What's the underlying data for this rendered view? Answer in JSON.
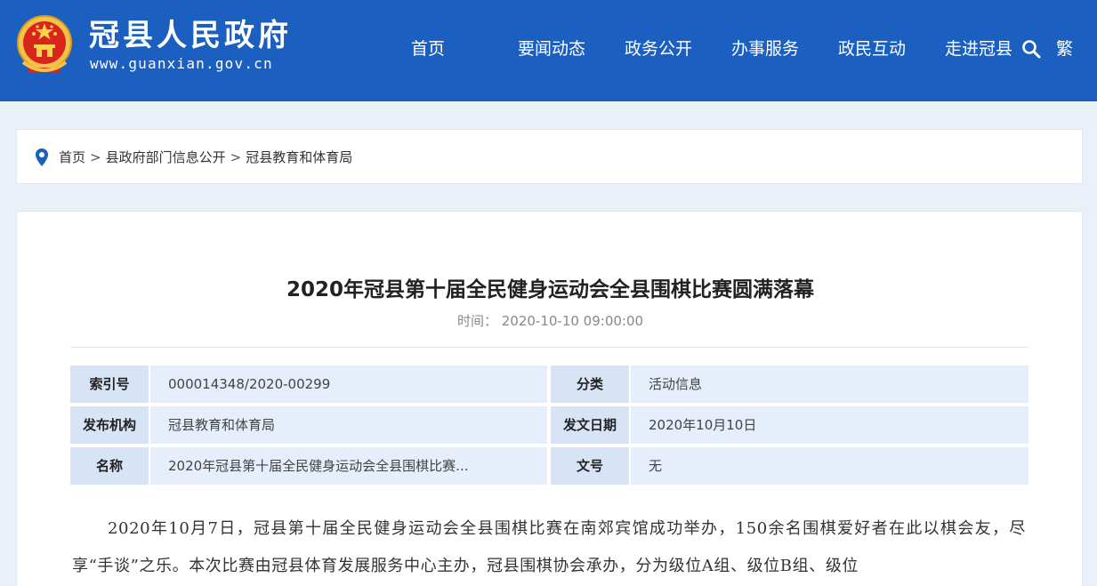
{
  "header": {
    "site_title": "冠县人民政府",
    "site_url": "www.guanxian.gov.cn",
    "nav": [
      "首页",
      "要闻动态",
      "政务公开",
      "办事服务",
      "政民互动",
      "走进冠县"
    ],
    "traditional_toggle": "繁",
    "colors": {
      "bar": "#1b5fc0",
      "text": "#ffffff"
    }
  },
  "breadcrumb": {
    "items": [
      "首页",
      "县政府部门信息公开",
      "冠县教育和体育局"
    ],
    "separator": ">"
  },
  "article": {
    "title": "2020年冠县第十届全民健身运动会全县围棋比赛圆满落幕",
    "time_label": "时间：",
    "time_value": "2020-10-10 09:00:00",
    "meta": [
      {
        "key": "索引号",
        "value": "000014348/2020-00299",
        "key2": "分类",
        "value2": "活动信息"
      },
      {
        "key": "发布机构",
        "value": "冠县教育和体育局",
        "key2": "发文日期",
        "value2": "2020年10月10日"
      },
      {
        "key": "名称",
        "value": "2020年冠县第十届全民健身运动会全县围棋比赛...",
        "key2": "文号",
        "value2": "无"
      }
    ],
    "body": "2020年10月7日，冠县第十届全民健身运动会全县围棋比赛在南郊宾馆成功举办，150余名围棋爱好者在此以棋会友，尽享“手谈”之乐。本次比赛由冠县体育发展服务中心主办，冠县围棋协会承办，分为级位A组、级位B组、级位"
  }
}
